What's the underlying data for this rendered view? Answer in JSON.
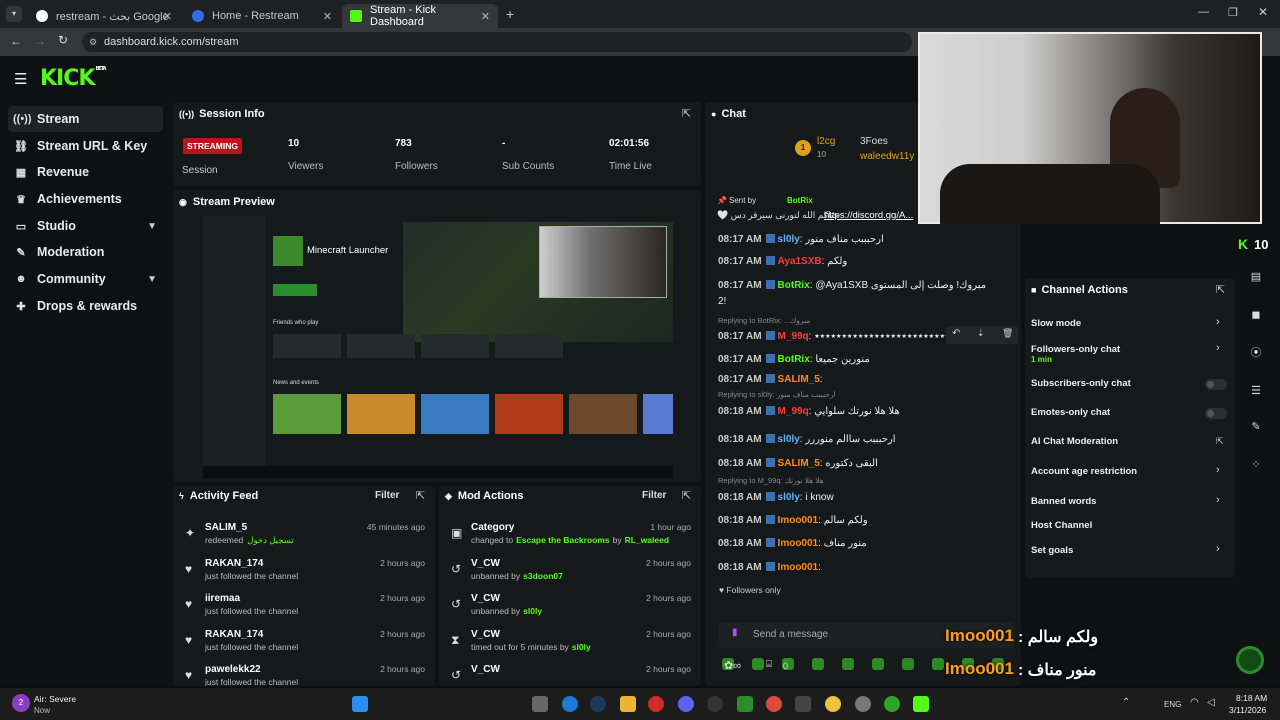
{
  "browser": {
    "tabs": [
      {
        "label": "restream - بحث Google",
        "active": false
      },
      {
        "label": "Home - Restream",
        "active": false
      },
      {
        "label": "Stream - Kick Dashboard",
        "active": true
      }
    ],
    "url": "dashboard.kick.com/stream"
  },
  "brand": {
    "logo": "KICK",
    "badge": "BETA",
    "accent": "#53fc18"
  },
  "sidebar": {
    "items": [
      {
        "label": "Stream",
        "icon": "signal-icon",
        "glyph": "((•))",
        "active": true
      },
      {
        "label": "Stream URL & Key",
        "icon": "link-icon",
        "glyph": "🔗"
      },
      {
        "label": "Revenue",
        "icon": "chart-icon",
        "glyph": "▦"
      },
      {
        "label": "Achievements",
        "icon": "trophy-icon",
        "glyph": "🏆"
      },
      {
        "label": "Studio",
        "icon": "monitor-icon",
        "glyph": "▭",
        "expandable": true
      },
      {
        "label": "Moderation",
        "icon": "wrench-icon",
        "glyph": "🔧"
      },
      {
        "label": "Community",
        "icon": "people-icon",
        "glyph": "👥",
        "expandable": true
      },
      {
        "label": "Drops & rewards",
        "icon": "gift-icon",
        "glyph": "🎁"
      }
    ]
  },
  "session": {
    "title": "Session Info",
    "status_badge": "STREAMING",
    "status_caption": "Session",
    "stats": [
      {
        "value": "10",
        "label": "Viewers"
      },
      {
        "value": "783",
        "label": "Followers"
      },
      {
        "value": "-",
        "label": "Sub Counts"
      },
      {
        "value": "02:01:56",
        "label": "Time Live"
      }
    ]
  },
  "preview": {
    "title": "Stream Preview",
    "launcher_title": "Minecraft Launcher",
    "friends": "Friends who play",
    "news": "News and events"
  },
  "activity": {
    "title": "Activity Feed",
    "filter": "Filter",
    "items": [
      {
        "name": "SALIM_5",
        "sub": "redeemed",
        "sub2": "تسجيل دخول",
        "time": "45 minutes ago",
        "icon": "redeem-icon",
        "glyph": "✦"
      },
      {
        "name": "RAKAN_174",
        "sub": "just followed the channel",
        "time": "2 hours ago",
        "icon": "heart-icon",
        "glyph": "♥"
      },
      {
        "name": "iiremaa",
        "sub": "just followed the channel",
        "time": "2 hours ago",
        "icon": "heart-icon",
        "glyph": "♥"
      },
      {
        "name": "RAKAN_174",
        "sub": "just followed the channel",
        "time": "2 hours ago",
        "icon": "heart-icon",
        "glyph": "♥"
      },
      {
        "name": "pawelekk22",
        "sub": "just followed the channel",
        "time": "2 hours ago",
        "icon": "heart-icon",
        "glyph": "♥"
      }
    ]
  },
  "modactions": {
    "title": "Mod Actions",
    "filter": "Filter",
    "items": [
      {
        "name": "Category",
        "pre": "changed to",
        "hl": "Escape the Backrooms",
        "mid": "by",
        "by": "RL_waleed",
        "time": "1 hour ago",
        "icon": "category-icon",
        "glyph": "▣"
      },
      {
        "name": "V_CW",
        "pre": "unbanned by",
        "hl": "",
        "mid": "",
        "by": "s3doon07",
        "time": "2 hours ago",
        "icon": "undo-icon",
        "glyph": "↺"
      },
      {
        "name": "V_CW",
        "pre": "unbanned by",
        "hl": "",
        "mid": "",
        "by": "sl0ly",
        "time": "2 hours ago",
        "icon": "undo-icon",
        "glyph": "↺"
      },
      {
        "name": "V_CW",
        "pre": "timed out for 5 minutes by",
        "hl": "",
        "mid": "",
        "by": "sl0ly",
        "time": "2 hours ago",
        "icon": "hourglass-icon",
        "glyph": "⧗"
      },
      {
        "name": "V_CW",
        "pre": "",
        "hl": "",
        "mid": "",
        "by": "",
        "time": "2 hours ago",
        "icon": "undo-icon",
        "glyph": "↺"
      }
    ]
  },
  "chat": {
    "title": "Chat",
    "top_users": [
      {
        "name": "l2cg",
        "count": "10"
      },
      {
        "name": "3Foes",
        "count": ""
      },
      {
        "name": "waleedw11y",
        "count": ""
      }
    ],
    "pinned_by_label": "Sent by",
    "pinned_by": "BotRix",
    "pinned_text": "حياكم الله لتورنى سيرفر دس 🤍",
    "pinned_link": "https://discord.gg/A...",
    "messages": [
      {
        "time": "08:17 AM",
        "user": "sl0ly",
        "color": "#5fb3ff",
        "text": ": ارحبببب مناف منور"
      },
      {
        "time": "08:17 AM",
        "user": "Aya1SXB",
        "color": "#ff3b3b",
        "text": ": ولكم"
      },
      {
        "time": "08:17 AM",
        "user": "BotRix",
        "color": "#53fc18",
        "text": ": @Aya1SXB مبروك! وصلت إلى المستوى"
      },
      {
        "time": "",
        "user": "",
        "color": "#eee",
        "text": "2!"
      },
      {
        "time": "08:17 AM",
        "user": "M_99q",
        "color": "#ff3b3b",
        "text": ": ٭٭٭٭٭٭٭٭٭٭٭٭٭٭٭٭٭٭٭٭٭٭٭٭٭٭٭٭٭٭",
        "reply": "Replying to BotRix: ...مبروك"
      },
      {
        "time": "08:17 AM",
        "user": "BotRix",
        "color": "#53fc18",
        "text": ": منورين جميعا"
      },
      {
        "time": "08:17 AM",
        "user": "SALIM_5",
        "color": "#ff8a1a",
        "text": ": "
      },
      {
        "time": "08:18 AM",
        "user": "M_99q",
        "color": "#ff3b3b",
        "text": ": هلا هلا نورتك سلوايي",
        "reply": "Replying to sl0ly: ارحبببب مناف منور"
      },
      {
        "time": "08:18 AM",
        "user": "sl0ly",
        "color": "#5fb3ff",
        "text": ": ارحبببب ساالم منوررر"
      },
      {
        "time": "08:18 AM",
        "user": "SALIM_5",
        "color": "#ff8a1a",
        "text": ": البقى دكتوره"
      },
      {
        "time": "08:18 AM",
        "user": "sl0ly",
        "color": "#5fb3ff",
        "text": ": i know",
        "reply": "Replying to M_99q: هلا هلا نورتك"
      },
      {
        "time": "08:18 AM",
        "user": "Imoo001",
        "color": "#ff8a1a",
        "text": ": ولكم سالم"
      },
      {
        "time": "08:18 AM",
        "user": "Imoo001",
        "color": "#ff8a1a",
        "text": ": منور مناف"
      },
      {
        "time": "08:18 AM",
        "user": "Imoo001",
        "color": "#ff8a1a",
        "text": ": "
      }
    ],
    "followers_only": "Followers only",
    "input_placeholder": "Send a message",
    "points": "0"
  },
  "channel_actions": {
    "title": "Channel Actions",
    "viewer_count": "10",
    "items": [
      {
        "label": "Slow mode",
        "kind": "chevron"
      },
      {
        "label": "Followers-only chat",
        "sub": "1 min",
        "kind": "chevron"
      },
      {
        "label": "Subscribers-only chat",
        "kind": "toggle"
      },
      {
        "label": "Emotes-only chat",
        "kind": "toggle"
      },
      {
        "label": "AI Chat Moderation",
        "kind": "external"
      },
      {
        "label": "Account age restriction",
        "kind": "chevron"
      },
      {
        "label": "Banned words",
        "kind": "chevron"
      },
      {
        "label": "Host Channel",
        "kind": "none"
      },
      {
        "label": "Set goals",
        "kind": "chevron"
      }
    ]
  },
  "overlay": {
    "lines": [
      {
        "user": "Imoo001",
        "text": ": ولكم سالم"
      },
      {
        "user": "Imoo001",
        "text": ": منور مناف"
      },
      {
        "user": "oo001",
        "text": ":"
      }
    ]
  },
  "taskbar": {
    "weather_title": "Air: Severe",
    "weather_sub": "Now",
    "weather_badge": "2",
    "lang": "ENG",
    "time": "8:18 AM",
    "date": "3/11/2026"
  }
}
